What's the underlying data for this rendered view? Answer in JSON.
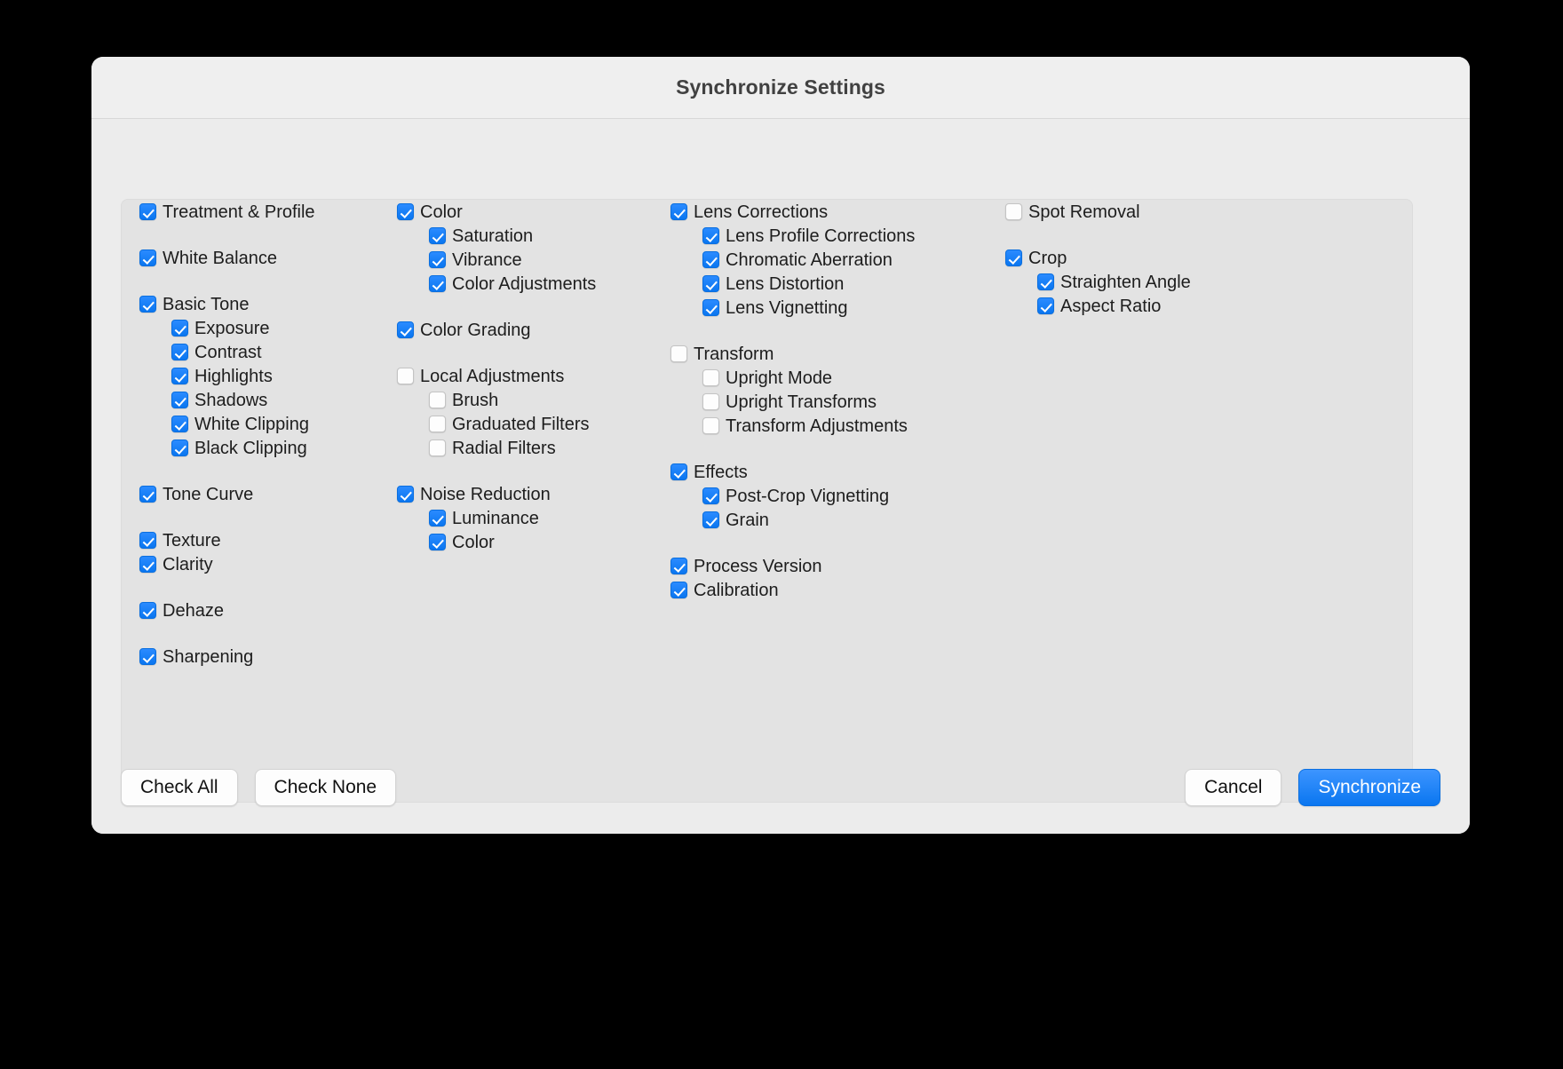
{
  "dialog": {
    "title": "Synchronize Settings",
    "accent_color": "#0a76f0",
    "background_color": "#ececec",
    "panel_color": "#e3e3e3"
  },
  "columns": [
    {
      "id": "column-1",
      "groups": [
        {
          "items": [
            {
              "label": "Treatment & Profile",
              "checked": true,
              "level": 0
            }
          ]
        },
        {
          "items": [
            {
              "label": "White Balance",
              "checked": true,
              "level": 0
            }
          ]
        },
        {
          "items": [
            {
              "label": "Basic Tone",
              "checked": true,
              "level": 0
            },
            {
              "label": "Exposure",
              "checked": true,
              "level": 1
            },
            {
              "label": "Contrast",
              "checked": true,
              "level": 1
            },
            {
              "label": "Highlights",
              "checked": true,
              "level": 1
            },
            {
              "label": "Shadows",
              "checked": true,
              "level": 1
            },
            {
              "label": "White Clipping",
              "checked": true,
              "level": 1
            },
            {
              "label": "Black Clipping",
              "checked": true,
              "level": 1
            }
          ]
        },
        {
          "items": [
            {
              "label": "Tone Curve",
              "checked": true,
              "level": 0
            }
          ]
        },
        {
          "items": [
            {
              "label": "Texture",
              "checked": true,
              "level": 0
            },
            {
              "label": "Clarity",
              "checked": true,
              "level": 0
            }
          ]
        },
        {
          "items": [
            {
              "label": "Dehaze",
              "checked": true,
              "level": 0
            }
          ]
        },
        {
          "items": [
            {
              "label": "Sharpening",
              "checked": true,
              "level": 0
            }
          ]
        }
      ]
    },
    {
      "id": "column-2",
      "groups": [
        {
          "items": [
            {
              "label": "Color",
              "checked": true,
              "level": 0
            },
            {
              "label": "Saturation",
              "checked": true,
              "level": 1
            },
            {
              "label": "Vibrance",
              "checked": true,
              "level": 1
            },
            {
              "label": "Color Adjustments",
              "checked": true,
              "level": 1
            }
          ]
        },
        {
          "items": [
            {
              "label": "Color Grading",
              "checked": true,
              "level": 0
            }
          ]
        },
        {
          "items": [
            {
              "label": "Local Adjustments",
              "checked": false,
              "level": 0
            },
            {
              "label": "Brush",
              "checked": false,
              "level": 1
            },
            {
              "label": "Graduated Filters",
              "checked": false,
              "level": 1
            },
            {
              "label": "Radial Filters",
              "checked": false,
              "level": 1
            }
          ]
        },
        {
          "items": [
            {
              "label": "Noise Reduction",
              "checked": true,
              "level": 0
            },
            {
              "label": "Luminance",
              "checked": true,
              "level": 1
            },
            {
              "label": "Color",
              "checked": true,
              "level": 1
            }
          ]
        }
      ]
    },
    {
      "id": "column-3",
      "groups": [
        {
          "items": [
            {
              "label": "Lens Corrections",
              "checked": true,
              "level": 0
            },
            {
              "label": "Lens Profile Corrections",
              "checked": true,
              "level": 1
            },
            {
              "label": "Chromatic Aberration",
              "checked": true,
              "level": 1
            },
            {
              "label": "Lens Distortion",
              "checked": true,
              "level": 1
            },
            {
              "label": "Lens Vignetting",
              "checked": true,
              "level": 1
            }
          ]
        },
        {
          "items": [
            {
              "label": "Transform",
              "checked": false,
              "level": 0
            },
            {
              "label": "Upright Mode",
              "checked": false,
              "level": 1
            },
            {
              "label": "Upright Transforms",
              "checked": false,
              "level": 1
            },
            {
              "label": "Transform Adjustments",
              "checked": false,
              "level": 1
            }
          ]
        },
        {
          "items": [
            {
              "label": "Effects",
              "checked": true,
              "level": 0
            },
            {
              "label": "Post-Crop Vignetting",
              "checked": true,
              "level": 1
            },
            {
              "label": "Grain",
              "checked": true,
              "level": 1
            }
          ]
        },
        {
          "items": [
            {
              "label": "Process Version",
              "checked": true,
              "level": 0
            },
            {
              "label": "Calibration",
              "checked": true,
              "level": 0
            }
          ]
        }
      ]
    },
    {
      "id": "column-4",
      "groups": [
        {
          "items": [
            {
              "label": "Spot Removal",
              "checked": false,
              "level": 0
            }
          ]
        },
        {
          "items": [
            {
              "label": "Crop",
              "checked": true,
              "level": 0
            },
            {
              "label": "Straighten Angle",
              "checked": true,
              "level": 1
            },
            {
              "label": "Aspect Ratio",
              "checked": true,
              "level": 1
            }
          ]
        }
      ]
    }
  ],
  "footer": {
    "check_all_label": "Check All",
    "check_none_label": "Check None",
    "cancel_label": "Cancel",
    "synchronize_label": "Synchronize"
  }
}
